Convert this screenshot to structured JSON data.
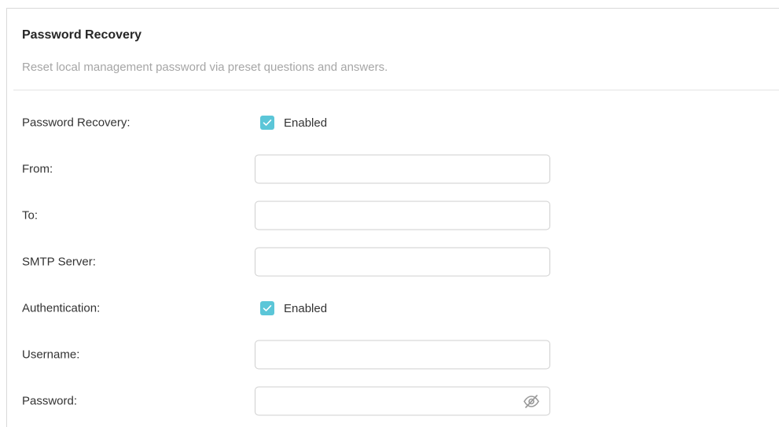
{
  "section": {
    "title": "Password Recovery",
    "subtitle": "Reset local management password via preset questions and answers."
  },
  "form": {
    "password_recovery": {
      "label": "Password Recovery:",
      "checked": true,
      "option_label": "Enabled"
    },
    "from": {
      "label": "From:",
      "value": "",
      "placeholder": ""
    },
    "to": {
      "label": "To:",
      "value": "",
      "placeholder": ""
    },
    "smtp_server": {
      "label": "SMTP Server:",
      "value": "",
      "placeholder": ""
    },
    "authentication": {
      "label": "Authentication:",
      "checked": true,
      "option_label": "Enabled"
    },
    "username": {
      "label": "Username:",
      "value": "",
      "placeholder": ""
    },
    "password": {
      "label": "Password:",
      "value": "",
      "placeholder": "",
      "visibility_icon": "eye-slash-icon"
    }
  },
  "colors": {
    "checkbox_accent": "#5bc6d8",
    "muted_text": "#a6a6a6",
    "icon": "#9a9a9a"
  }
}
